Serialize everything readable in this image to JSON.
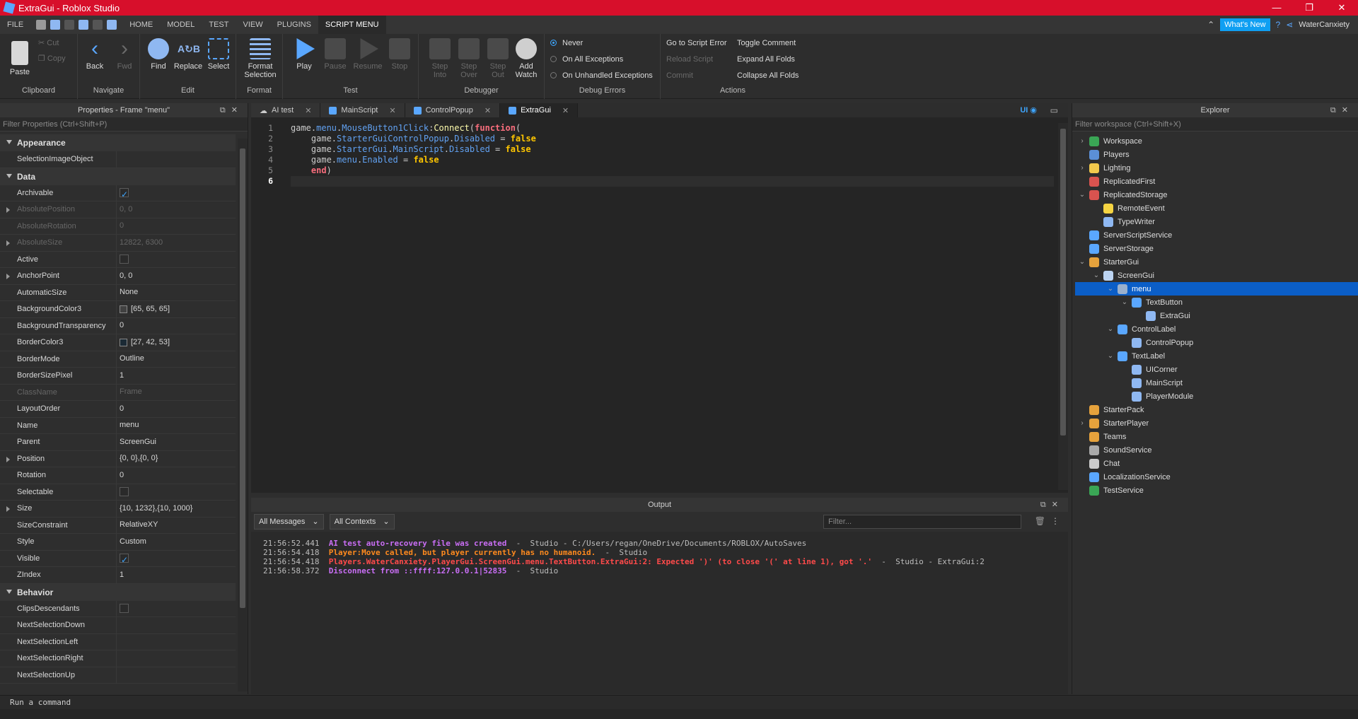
{
  "window": {
    "title": "ExtraGui - Roblox Studio",
    "controls": [
      "—",
      "❐",
      "✕"
    ]
  },
  "menubar": {
    "items": [
      "FILE",
      "HOME",
      "MODEL",
      "TEST",
      "VIEW",
      "PLUGINS",
      "SCRIPT MENU"
    ],
    "whats_new": "What's New",
    "user": "WaterCanxiety"
  },
  "ribbon": {
    "groups": [
      "Clipboard",
      "Navigate",
      "Edit",
      "Format",
      "Test",
      "Debugger",
      "Debug Errors",
      "Actions"
    ],
    "clipboard": {
      "paste": "Paste",
      "cut": "Cut",
      "copy": "Copy"
    },
    "navigate": {
      "back": "Back",
      "fwd": "Fwd"
    },
    "edit": {
      "find": "Find",
      "replace": "Replace",
      "select": "Select"
    },
    "format": {
      "line1": "Format",
      "line2": "Selection"
    },
    "test": {
      "play": "Play",
      "pause": "Pause",
      "resume": "Resume",
      "stop": "Stop"
    },
    "debugger": {
      "step_into_1": "Step",
      "step_into_2": "Into",
      "step_over_1": "Step",
      "step_over_2": "Over",
      "step_out_1": "Step",
      "step_out_2": "Out",
      "add_watch_1": "Add",
      "add_watch_2": "Watch"
    },
    "debug_errors": {
      "never": "Never",
      "all": "On All Exceptions",
      "unhandled": "On Unhandled Exceptions"
    },
    "actions": {
      "goto": "Go to Script Error",
      "reload": "Reload Script",
      "commit": "Commit",
      "toggle": "Toggle Comment",
      "expand": "Expand All Folds",
      "collapse": "Collapse All Folds"
    }
  },
  "properties": {
    "title": "Properties - Frame \"menu\"",
    "filter_placeholder": "Filter Properties (Ctrl+Shift+P)",
    "sections": {
      "appearance": "Appearance",
      "data": "Data",
      "behavior": "Behavior"
    },
    "appearance_rows": [
      {
        "k": "SelectionImageObject",
        "v": ""
      }
    ],
    "data_rows": [
      {
        "k": "Archivable",
        "v": "",
        "check": true
      },
      {
        "k": "AbsolutePosition",
        "v": "0, 0"
      },
      {
        "k": "AbsoluteRotation",
        "v": "0"
      },
      {
        "k": "AbsoluteSize",
        "v": "12822, 6300"
      },
      {
        "k": "Active",
        "v": "",
        "check": false
      },
      {
        "k": "AnchorPoint",
        "v": "0, 0"
      },
      {
        "k": "AutomaticSize",
        "v": "None"
      },
      {
        "k": "BackgroundColor3",
        "v": "[65, 65, 65]",
        "color": "#414141"
      },
      {
        "k": "BackgroundTransparency",
        "v": "0"
      },
      {
        "k": "BorderColor3",
        "v": "[27, 42, 53]",
        "color": "#1b2a35"
      },
      {
        "k": "BorderMode",
        "v": "Outline"
      },
      {
        "k": "BorderSizePixel",
        "v": "1"
      },
      {
        "k": "ClassName",
        "v": "Frame"
      },
      {
        "k": "LayoutOrder",
        "v": "0"
      },
      {
        "k": "Name",
        "v": "menu"
      },
      {
        "k": "Parent",
        "v": "ScreenGui"
      },
      {
        "k": "Position",
        "v": "{0, 0},{0, 0}"
      },
      {
        "k": "Rotation",
        "v": "0"
      },
      {
        "k": "Selectable",
        "v": "",
        "check": false
      },
      {
        "k": "Size",
        "v": "{10, 1232},{10, 1000}"
      },
      {
        "k": "SizeConstraint",
        "v": "RelativeXY"
      },
      {
        "k": "Style",
        "v": "Custom"
      },
      {
        "k": "Visible",
        "v": "",
        "check": true
      },
      {
        "k": "ZIndex",
        "v": "1"
      }
    ],
    "behavior_rows": [
      {
        "k": "ClipsDescendants",
        "v": "",
        "check": false
      },
      {
        "k": "NextSelectionDown",
        "v": ""
      },
      {
        "k": "NextSelectionLeft",
        "v": ""
      },
      {
        "k": "NextSelectionRight",
        "v": ""
      },
      {
        "k": "NextSelectionUp",
        "v": ""
      }
    ]
  },
  "editor": {
    "tabs": [
      "AI test",
      "MainScript",
      "ControlPopup",
      "ExtraGui"
    ],
    "active_tab": "ExtraGui",
    "ui_toggle": "UI",
    "line_numbers": [
      "1",
      "2",
      "3",
      "4",
      "5",
      "6"
    ],
    "code": {
      "l1_a": "game.",
      "l1_b": "menu",
      "l1_c": ".",
      "l1_d": "MouseButton1Click",
      "l1_e": ":",
      "l1_f": "Connect",
      "l1_g": "(",
      "l1_h": "function",
      "l1_i": "(",
      "l2_a": "    game.",
      "l2_b": "StarterGuiControlPopup",
      "l2_c": ".",
      "l2_d": "Disabled",
      "l2_e": " = ",
      "l2_f": "false",
      "l3_a": "    game.",
      "l3_b": "StarterGui",
      "l3_c": ".",
      "l3_d": "MainScript",
      "l3_e": ".",
      "l3_f": "Disabled",
      "l3_g": " = ",
      "l3_h": "false",
      "l4_a": "    game.",
      "l4_b": "menu",
      "l4_c": ".",
      "l4_d": "Enabled",
      "l4_e": " = ",
      "l4_f": "false",
      "l5_a": "    ",
      "l5_b": "end",
      "l5_c": ")"
    }
  },
  "output": {
    "title": "Output",
    "messages_filter": "All Messages",
    "contexts_filter": "All Contexts",
    "filter_placeholder": "Filter...",
    "lines": [
      {
        "time": "21:56:52.441",
        "msg": "AI test auto-recovery file was created",
        "src": "  -  Studio - C:/Users/regan/OneDrive/Documents/ROBLOX/AutoSaves"
      },
      {
        "time": "21:56:54.418",
        "msg": "Player:Move called, but player currently has no humanoid.",
        "src": "  -  Studio"
      },
      {
        "time": "21:56:54.418",
        "msg": "Players.WaterCanxiety.PlayerGui.ScreenGui.menu.TextButton.ExtraGui:2: Expected ')' (to close '(' at line 1), got '.'",
        "src": "  -  Studio - ExtraGui:2"
      },
      {
        "time": "21:56:58.372",
        "msg": "Disconnect from ::ffff:127.0.0.1|52835",
        "src": "  -  Studio"
      }
    ]
  },
  "explorer": {
    "title": "Explorer",
    "filter_placeholder": "Filter workspace (Ctrl+Shift+X)",
    "nodes": [
      {
        "label": "Workspace",
        "depth": 0,
        "arrow": "›",
        "color": "#3aa655"
      },
      {
        "label": "Players",
        "depth": 0,
        "arrow": "",
        "color": "#5b8fd6"
      },
      {
        "label": "Lighting",
        "depth": 0,
        "arrow": "›",
        "color": "#f2c94c"
      },
      {
        "label": "ReplicatedFirst",
        "depth": 0,
        "arrow": "",
        "color": "#d9534f"
      },
      {
        "label": "ReplicatedStorage",
        "depth": 0,
        "arrow": "⌄",
        "color": "#d9534f"
      },
      {
        "label": "RemoteEvent",
        "depth": 1,
        "arrow": "",
        "color": "#f5d442"
      },
      {
        "label": "TypeWriter",
        "depth": 1,
        "arrow": "",
        "color": "#8fb8f2"
      },
      {
        "label": "ServerScriptService",
        "depth": 0,
        "arrow": "",
        "color": "#5aa7ff"
      },
      {
        "label": "ServerStorage",
        "depth": 0,
        "arrow": "",
        "color": "#5aa7ff"
      },
      {
        "label": "StarterGui",
        "depth": 0,
        "arrow": "⌄",
        "color": "#e6a23c"
      },
      {
        "label": "ScreenGui",
        "depth": 1,
        "arrow": "⌄",
        "color": "#bcd4f2"
      },
      {
        "label": "menu",
        "depth": 2,
        "arrow": "⌄",
        "color": "#9ab0cc",
        "selected": true
      },
      {
        "label": "TextButton",
        "depth": 3,
        "arrow": "⌄",
        "color": "#5aa7ff"
      },
      {
        "label": "ExtraGui",
        "depth": 4,
        "arrow": "",
        "color": "#8fb8f2"
      },
      {
        "label": "ControlLabel",
        "depth": 2,
        "arrow": "⌄",
        "color": "#5aa7ff"
      },
      {
        "label": "ControlPopup",
        "depth": 3,
        "arrow": "",
        "color": "#8fb8f2"
      },
      {
        "label": "TextLabel",
        "depth": 2,
        "arrow": "⌄",
        "color": "#5aa7ff"
      },
      {
        "label": "UICorner",
        "depth": 3,
        "arrow": "",
        "color": "#8fb8f2"
      },
      {
        "label": "MainScript",
        "depth": 3,
        "arrow": "",
        "color": "#8fb8f2"
      },
      {
        "label": "PlayerModule",
        "depth": 3,
        "arrow": "",
        "color": "#8fb8f2"
      },
      {
        "label": "StarterPack",
        "depth": 0,
        "arrow": "",
        "color": "#e6a23c"
      },
      {
        "label": "StarterPlayer",
        "depth": 0,
        "arrow": "›",
        "color": "#e6a23c"
      },
      {
        "label": "Teams",
        "depth": 0,
        "arrow": "",
        "color": "#e6a23c"
      },
      {
        "label": "SoundService",
        "depth": 0,
        "arrow": "",
        "color": "#aaaaaa"
      },
      {
        "label": "Chat",
        "depth": 0,
        "arrow": "",
        "color": "#cccccc"
      },
      {
        "label": "LocalizationService",
        "depth": 0,
        "arrow": "",
        "color": "#5aa7ff"
      },
      {
        "label": "TestService",
        "depth": 0,
        "arrow": "",
        "color": "#3aa655"
      }
    ]
  },
  "command_bar": {
    "placeholder": "Run a command"
  }
}
